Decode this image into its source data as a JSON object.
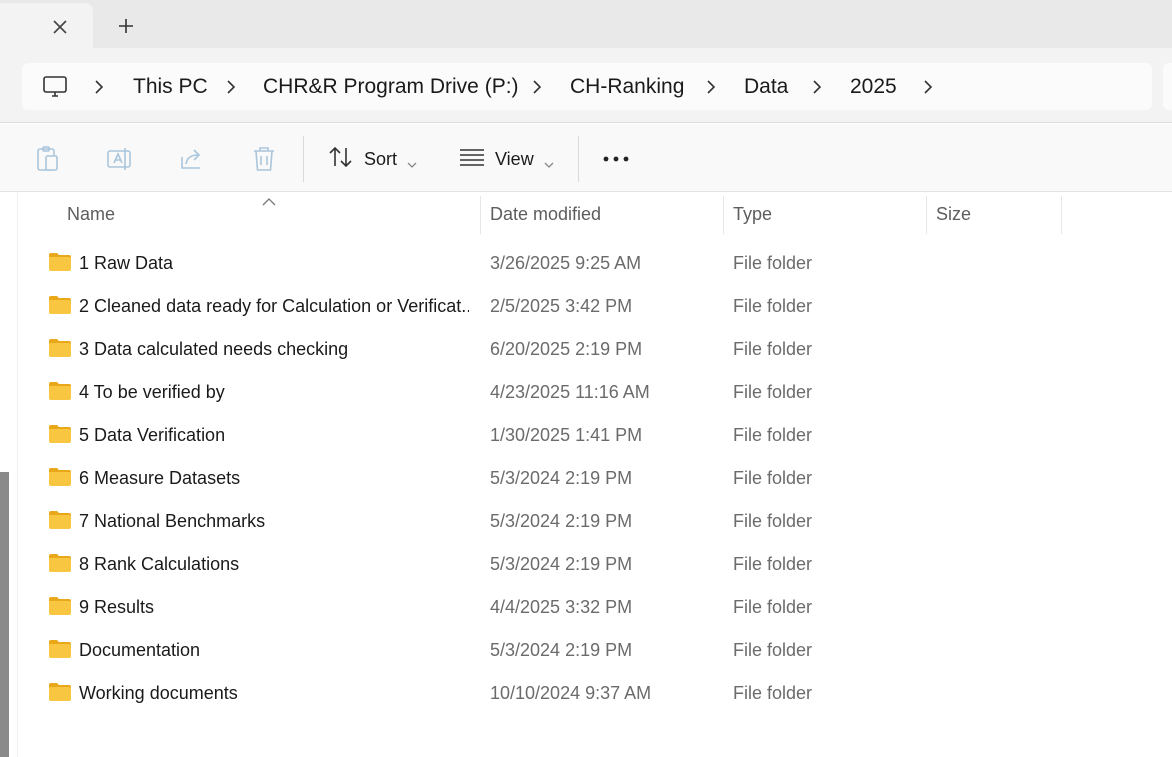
{
  "window": {
    "tab": {
      "close_icon": "close-icon"
    },
    "new_tab_icon": "plus-icon"
  },
  "address_bar": {
    "root_icon": "monitor-icon",
    "breadcrumbs": [
      "This PC",
      "CHR&R Program Drive (P:)",
      "CH-Ranking",
      "Data",
      "2025"
    ]
  },
  "command_bar": {
    "icons": [
      "paste-icon",
      "rename-icon",
      "share-icon",
      "delete-icon"
    ],
    "sort_label": "Sort",
    "view_label": "View",
    "more_icon": "more-icon"
  },
  "file_list": {
    "columns": [
      "Name",
      "Date modified",
      "Type",
      "Size"
    ],
    "sorted_by": "Name",
    "rows": [
      {
        "name": "1 Raw Data",
        "date": "3/26/2025 9:25 AM",
        "type": "File folder",
        "size": ""
      },
      {
        "name": "2 Cleaned data ready for Calculation or Verificat...",
        "date": "2/5/2025 3:42 PM",
        "type": "File folder",
        "size": ""
      },
      {
        "name": "3 Data calculated needs checking",
        "date": "6/20/2025 2:19 PM",
        "type": "File folder",
        "size": ""
      },
      {
        "name": "4 To be verified by",
        "date": "4/23/2025 11:16 AM",
        "type": "File folder",
        "size": ""
      },
      {
        "name": "5 Data Verification",
        "date": "1/30/2025 1:41 PM",
        "type": "File folder",
        "size": ""
      },
      {
        "name": "6 Measure Datasets",
        "date": "5/3/2024 2:19 PM",
        "type": "File folder",
        "size": ""
      },
      {
        "name": "7 National Benchmarks",
        "date": "5/3/2024 2:19 PM",
        "type": "File folder",
        "size": ""
      },
      {
        "name": "8 Rank Calculations",
        "date": "5/3/2024 2:19 PM",
        "type": "File folder",
        "size": ""
      },
      {
        "name": "9 Results",
        "date": "4/4/2025 3:32 PM",
        "type": "File folder",
        "size": ""
      },
      {
        "name": "Documentation",
        "date": "5/3/2024 2:19 PM",
        "type": "File folder",
        "size": ""
      },
      {
        "name": "Working documents",
        "date": "10/10/2024 9:37 AM",
        "type": "File folder",
        "size": ""
      }
    ]
  },
  "colors": {
    "folder": "#f8c640",
    "folder_dark": "#e9a819",
    "muted_text": "#6b6b6b",
    "disabled_icon": "#a9c6dc"
  }
}
